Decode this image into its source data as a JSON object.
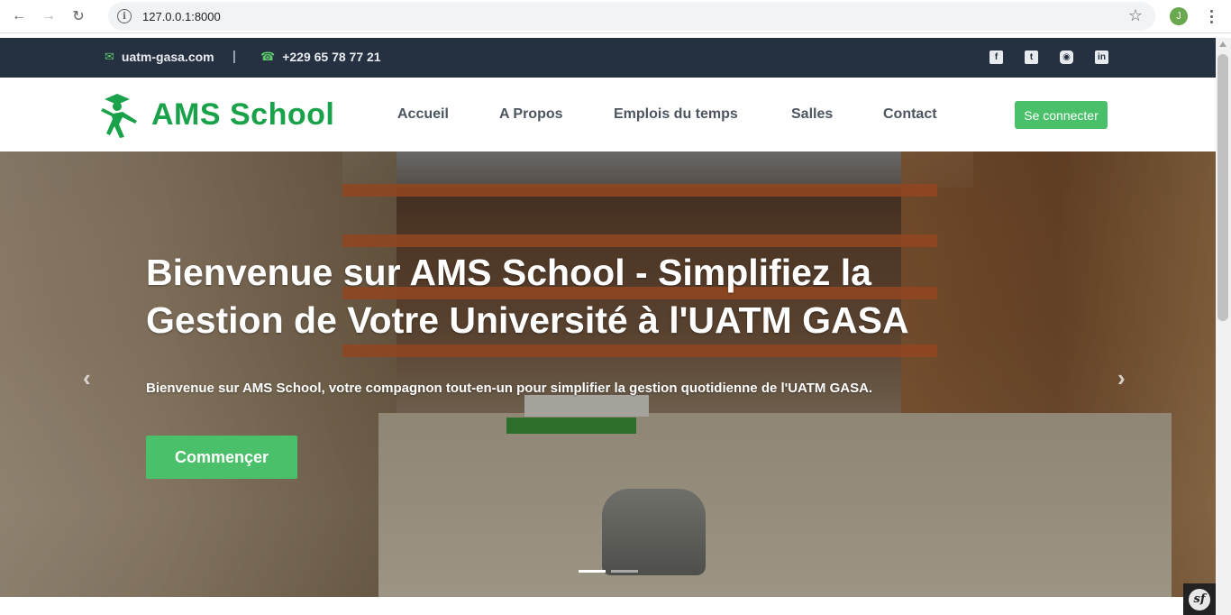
{
  "browser": {
    "url": "127.0.0.1:8000",
    "profile_initial": "J"
  },
  "topbar": {
    "email": "uatm-gasa.com",
    "separator": "|",
    "phone": "+229 65 78 77 21",
    "social_icons": [
      "facebook-icon",
      "twitter-icon",
      "instagram-icon",
      "linkedin-icon"
    ]
  },
  "header": {
    "brand": "AMS School",
    "nav": [
      "Accueil",
      "A Propos",
      "Emplois du temps",
      "Salles",
      "Contact"
    ],
    "login_label": "Se connecter"
  },
  "hero": {
    "title": "Bienvenue sur AMS School - Simplifiez la Gestion de Votre Université à l'UATM GASA",
    "subtitle": "Bienvenue sur AMS School, votre compagnon tout-en-un pour simplifier la gestion quotidienne de l'UATM GASA.",
    "cta_label": "Commençer",
    "prev_arrow": "‹",
    "next_arrow": "›",
    "active_slide": 1,
    "slide_count": 2
  },
  "colors": {
    "accent": "#4bc06a",
    "brand": "#1aa24a",
    "topbar_bg": "#253041"
  },
  "debug_toolbar": {
    "symbol": "sf"
  }
}
